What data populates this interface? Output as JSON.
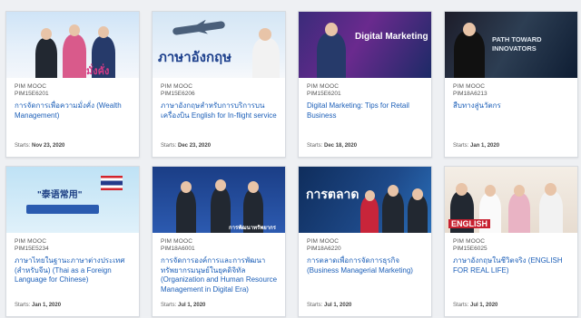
{
  "courses": [
    {
      "provider": "PIM MOOC",
      "code": "PIM15E6201",
      "title": "การจัดการเพื่อความมั่งคั่ง (Wealth Management)",
      "starts_label": "Starts:",
      "starts_date": "Nov 23, 2020",
      "thumb_text": "มั่งคั่ง",
      "thumb_icon": "group-photo"
    },
    {
      "provider": "PIM MOOC",
      "code": "PIM15E6206",
      "title": "ภาษาอังกฤษสำหรับการบริการบนเครื่องบิน English for In-flight service",
      "starts_label": "Starts:",
      "starts_date": "Dec 23, 2020",
      "thumb_text": "ภาษาอังกฤษ",
      "thumb_icon": "airplane"
    },
    {
      "provider": "PIM MOOC",
      "code": "PIM15E6201",
      "title": "Digital Marketing: Tips for Retail Business",
      "starts_label": "Starts:",
      "starts_date": "Dec 18, 2020",
      "thumb_text": "Digital Marketing",
      "thumb_icon": "presenter"
    },
    {
      "provider": "PIM MOOC",
      "code": "PIM18A6213",
      "title": "สืบทางสู่นวัตกร",
      "starts_label": "Starts:",
      "starts_date": "Jan 1, 2020",
      "thumb_text": "PATH TOWARD INNOVATORS",
      "thumb_icon": "presenter"
    },
    {
      "provider": "PIM MOOC",
      "code": "PIM15E5234",
      "title": "ภาษาไทยในฐานะภาษาต่างประเทศ (สำหรับจีน) (Thai as a Foreign Language for Chinese)",
      "starts_label": "Starts:",
      "starts_date": "Jan 1, 2020",
      "thumb_text": "\"泰语常用\"",
      "thumb_icon": "thai-flag"
    },
    {
      "provider": "PIM MOOC",
      "code": "PIM18A6001",
      "title": "การจัดการองค์การและการพัฒนาทรัพยากรมนุษย์ในยุคดิจิทัล (Organization and Human Resource Management in Digital Era)",
      "starts_label": "Starts:",
      "starts_date": "Jul 1, 2020",
      "thumb_text": "การพัฒนาทรัพยากร",
      "thumb_icon": "group-photo"
    },
    {
      "provider": "PIM MOOC",
      "code": "PIM18A6220",
      "title": "การตลาดเพื่อการจัดการธุรกิจ (Business Managerial Marketing)",
      "starts_label": "Starts:",
      "starts_date": "Jul 1, 2020",
      "thumb_text": "การตลาด",
      "thumb_icon": "group-photo"
    },
    {
      "provider": "PIM MOOC",
      "code": "PIM15E6025",
      "title": "ภาษาอังกฤษในชีวิตจริง (ENGLISH FOR REAL LIFE)",
      "starts_label": "Starts:",
      "starts_date": "Jul 1, 2020",
      "thumb_text": "ENGLISH",
      "thumb_icon": "group-photo"
    }
  ]
}
